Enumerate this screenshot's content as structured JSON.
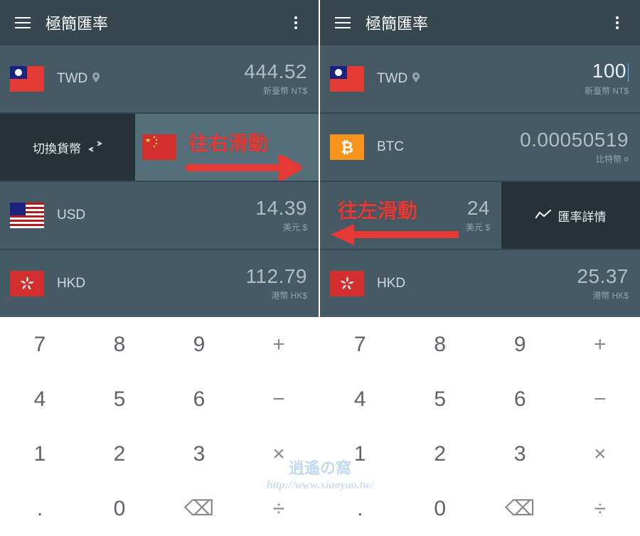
{
  "app_title": "極簡匯率",
  "left": {
    "rows": [
      {
        "code": "TWD",
        "pin": true,
        "value": "444.52",
        "sub": "新臺幣 NT$"
      },
      {
        "swipe": true,
        "action_label": "切換貨幣",
        "hidden_code": "CNY"
      },
      {
        "code": "USD",
        "pin": false,
        "value": "14.39",
        "sub": "美元 $"
      },
      {
        "code": "HKD",
        "pin": false,
        "value": "112.79",
        "sub": "港幣 HK$"
      }
    ],
    "annotation": "往右滑動"
  },
  "right": {
    "rows": [
      {
        "code": "TWD",
        "pin": true,
        "value": "100",
        "sub": "新臺幣 NT$",
        "cursor": true
      },
      {
        "code": "BTC",
        "pin": false,
        "value": "0.00050519",
        "sub": "比特幣 ¤"
      },
      {
        "swipe": true,
        "action_label": "匯率詳情",
        "hidden_code": "USD",
        "hidden_value": "24",
        "hidden_sub": "美元 $"
      },
      {
        "code": "HKD",
        "pin": false,
        "value": "25.37",
        "sub": "港幣 HK$"
      }
    ],
    "annotation": "往左滑動"
  },
  "keypad": {
    "rows": [
      [
        "7",
        "8",
        "9",
        "+"
      ],
      [
        "4",
        "5",
        "6",
        "−"
      ],
      [
        "1",
        "2",
        "3",
        "×"
      ],
      [
        ".",
        "0",
        "⌫",
        "÷"
      ]
    ]
  },
  "watermark": {
    "title": "逍遙の窩",
    "url": "http://www.xiaoyao.tw/"
  }
}
